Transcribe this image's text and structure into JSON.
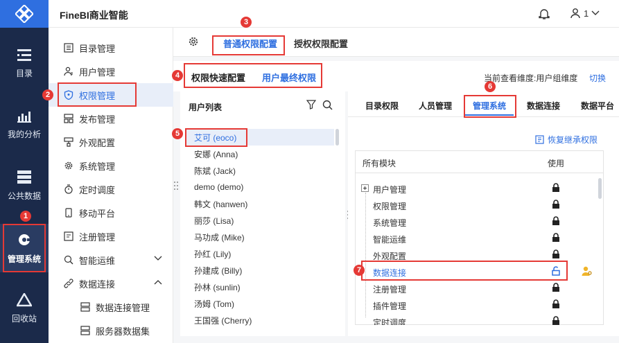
{
  "app": {
    "brand": "FineBI商业智能",
    "user_name": "1"
  },
  "rail": {
    "items": [
      {
        "label": "目录",
        "icon": "catalog-icon"
      },
      {
        "label": "我的分析",
        "icon": "analysis-icon"
      },
      {
        "label": "公共数据",
        "icon": "public-data-icon"
      },
      {
        "label": "管理系统",
        "icon": "admin-system-icon"
      },
      {
        "label": "回收站",
        "icon": "recycle-bin-icon"
      }
    ]
  },
  "subnav": {
    "items": [
      {
        "label": "目录管理",
        "icon": "catalog-manage-icon"
      },
      {
        "label": "用户管理",
        "icon": "user-manage-icon"
      },
      {
        "label": "权限管理",
        "icon": "permission-icon"
      },
      {
        "label": "发布管理",
        "icon": "publish-icon"
      },
      {
        "label": "外观配置",
        "icon": "appearance-icon"
      },
      {
        "label": "系统管理",
        "icon": "gear-icon"
      },
      {
        "label": "定时调度",
        "icon": "timer-icon"
      },
      {
        "label": "移动平台",
        "icon": "mobile-icon"
      },
      {
        "label": "注册管理",
        "icon": "register-icon"
      },
      {
        "label": "智能运维",
        "icon": "ops-icon"
      },
      {
        "label": "数据连接",
        "icon": "link-icon"
      },
      {
        "label": "数据连接管理",
        "icon": "connection-manage-icon"
      },
      {
        "label": "服务器数据集",
        "icon": "server-dataset-icon"
      }
    ]
  },
  "top_tabs": {
    "normal": "普通权限配置",
    "grant": "授权权限配置"
  },
  "quick": {
    "quick_config": "权限快速配置",
    "final_perm": "用户最终权限",
    "dimension": "当前查看维度:用户组维度",
    "switch": "切换"
  },
  "user_list": {
    "title": "用户列表",
    "users": [
      "艾可 (eoco)",
      "安娜 (Anna)",
      "陈斌 (Jack)",
      "demo (demo)",
      "韩文 (hanwen)",
      "丽莎 (Lisa)",
      "马功成 (Mike)",
      "孙红 (Lily)",
      "孙建成 (Billy)",
      "孙林 (sunlin)",
      "汤姆 (Tom)",
      "王国强 (Cherry)"
    ]
  },
  "right_tabs": [
    "目录权限",
    "人员管理",
    "管理系统",
    "数据连接",
    "数据平台"
  ],
  "restore": "恢复继承权限",
  "module_table": {
    "col_module": "所有模块",
    "col_use": "使用",
    "rows": [
      "用户管理",
      "权限管理",
      "系统管理",
      "智能运维",
      "外观配置",
      "数据连接",
      "注册管理",
      "插件管理",
      "定时调度"
    ]
  },
  "badges": [
    "1",
    "2",
    "3",
    "4",
    "5",
    "6",
    "7"
  ],
  "colors": {
    "accent": "#2f6fe0",
    "rail_bg": "#1b2a4a",
    "highlight": "#e53935"
  }
}
